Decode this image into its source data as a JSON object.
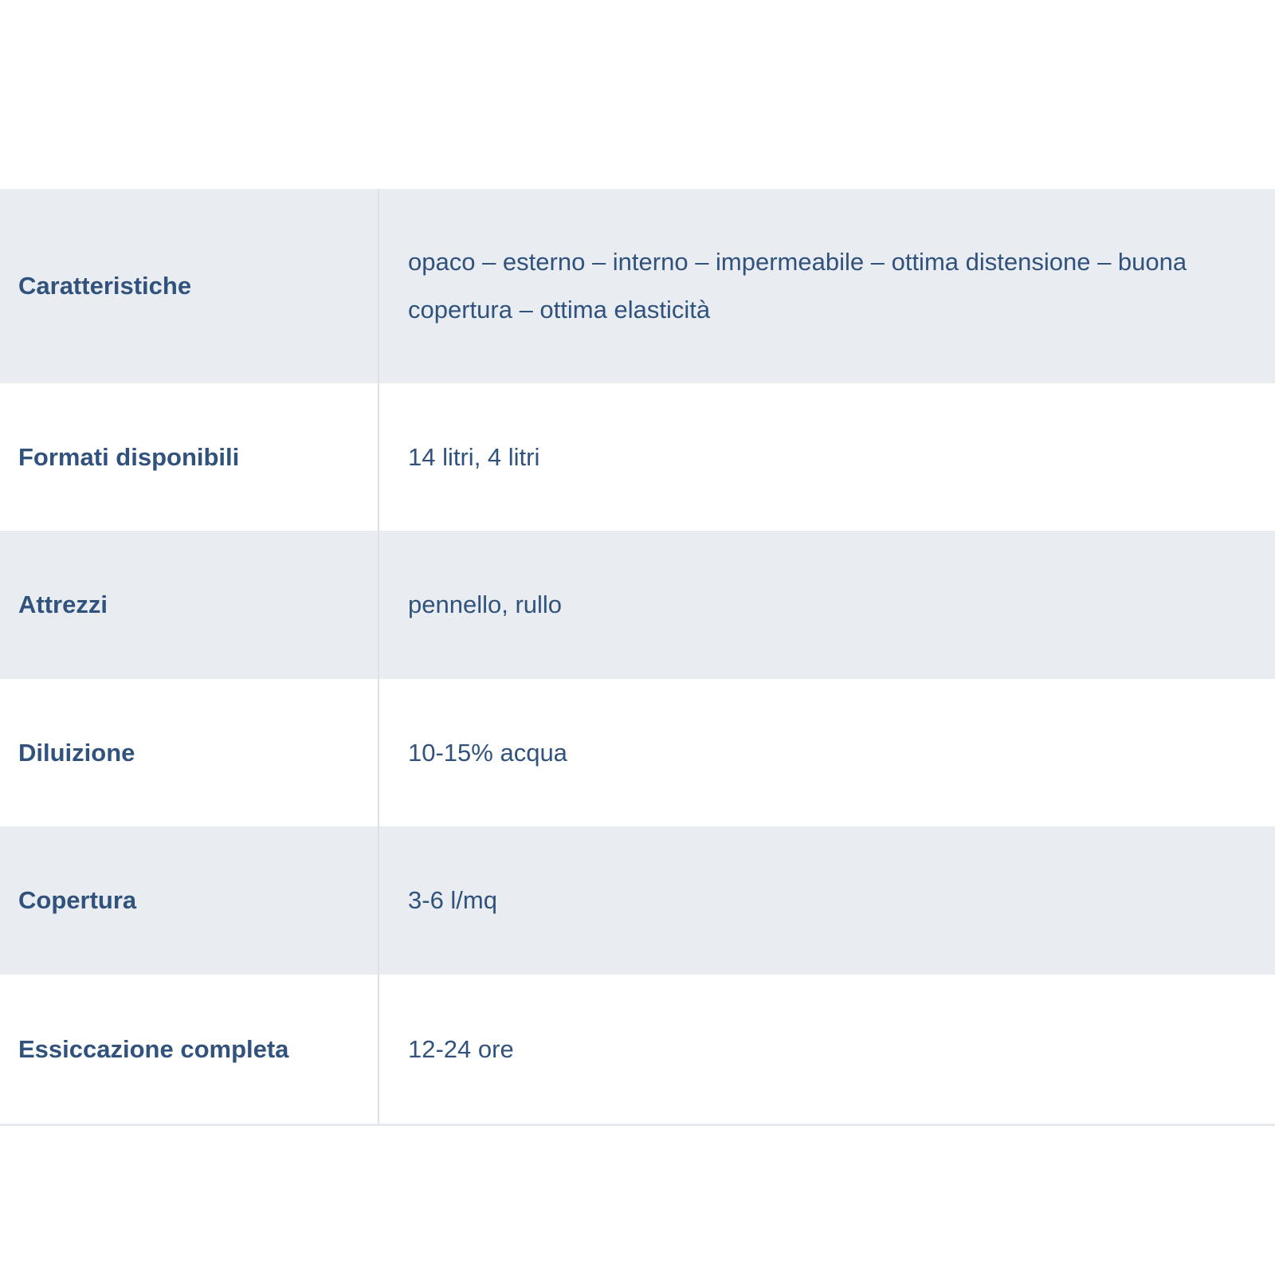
{
  "spec_table": {
    "rows": [
      {
        "label": "Caratteristiche",
        "value": "opaco – esterno – interno – impermeabile – ottima distensione – buona copertura – ottima elasticità"
      },
      {
        "label": "Formati disponibili",
        "value": "14 litri, 4 litri"
      },
      {
        "label": "Attrezzi",
        "value": "pennello, rullo"
      },
      {
        "label": "Diluizione",
        "value": "10-15% acqua"
      },
      {
        "label": "Copertura",
        "value": "3-6 l/mq"
      },
      {
        "label": "Essiccazione completa",
        "value": "12-24 ore"
      }
    ]
  },
  "colors": {
    "label_text": "#30527c",
    "value_text": "#3d5879",
    "shaded_row": "#e9edf1",
    "divider": "#dde2e7"
  }
}
